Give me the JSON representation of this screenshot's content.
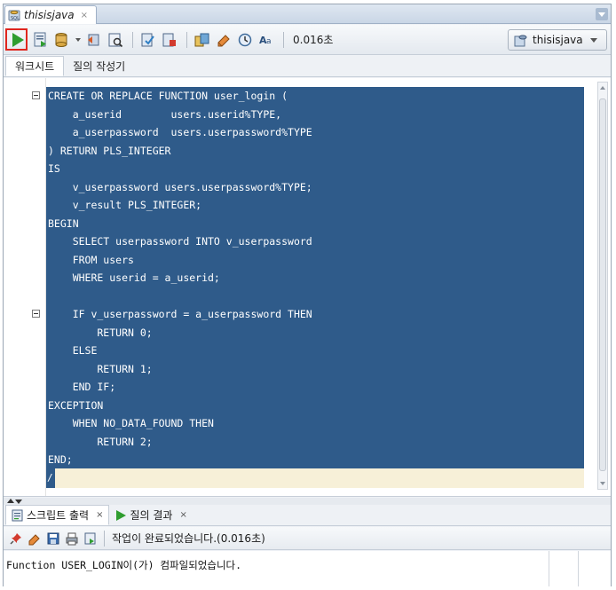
{
  "document_tab": {
    "title": "thisisjava",
    "close": "×"
  },
  "toolbar": {
    "run_statement": "run-statement",
    "elapsed": "0.016초",
    "connection": "thisisjava"
  },
  "subtabs": [
    {
      "label": "워크시트"
    },
    {
      "label": "질의 작성기"
    }
  ],
  "editor": {
    "lines": [
      "CREATE OR REPLACE FUNCTION user_login (",
      "    a_userid        users.userid%TYPE,",
      "    a_userpassword  users.userpassword%TYPE",
      ") RETURN PLS_INTEGER",
      "IS",
      "    v_userpassword users.userpassword%TYPE;",
      "    v_result PLS_INTEGER;",
      "BEGIN",
      "    SELECT userpassword INTO v_userpassword",
      "    FROM users",
      "    WHERE userid = a_userid;",
      "",
      "    IF v_userpassword = a_userpassword THEN",
      "        RETURN 0;",
      "    ELSE",
      "        RETURN 1;",
      "    END IF;",
      "EXCEPTION",
      "    WHEN NO_DATA_FOUND THEN",
      "        RETURN 2;",
      "END;"
    ],
    "last_line": "/"
  },
  "bottom_tabs": [
    {
      "label": "스크립트 출력",
      "close": "×"
    },
    {
      "label": "질의 결과",
      "close": "×"
    }
  ],
  "output_toolbar": {
    "message": "작업이 완료되었습니다.(0.016초)"
  },
  "output": {
    "text": "Function USER_LOGIN이(가) 컴파일되었습니다."
  },
  "colors": {
    "selection": "#2f5b8a",
    "run_highlight": "#e0261e",
    "run_icon": "#2f9d2f",
    "current_line": "#f7f0d8"
  }
}
